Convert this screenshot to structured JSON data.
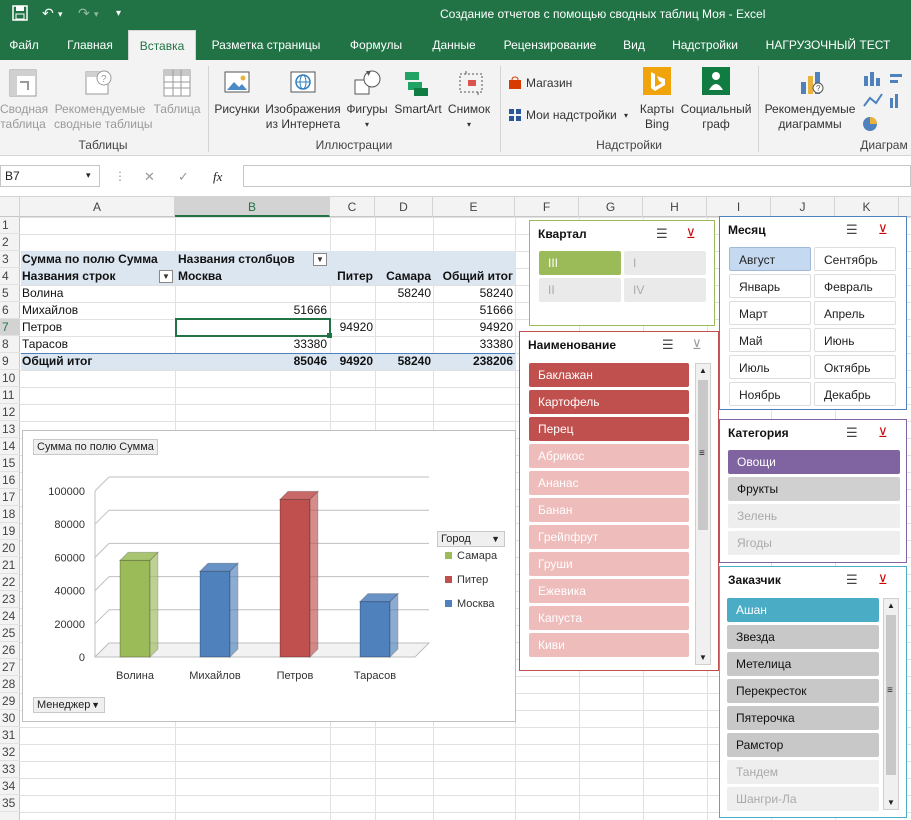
{
  "window": {
    "title": "Создание отчетов с помощью сводных таблиц Моя - Excel"
  },
  "tabs": [
    "Файл",
    "Главная",
    "Вставка",
    "Разметка страницы",
    "Формулы",
    "Данные",
    "Рецензирование",
    "Вид",
    "Надстройки",
    "НАГРУЗОЧНЫЙ ТЕСТ"
  ],
  "ribbon": {
    "pivot_1": "Сводная",
    "pivot_2": "таблица",
    "recpivot_1": "Рекомендуемые",
    "recpivot_2": "сводные таблицы",
    "table": "Таблица",
    "pictures": "Рисунки",
    "online_1": "Изображения",
    "online_2": "из Интернета",
    "shapes": "Фигуры",
    "smartart": "SmartArt",
    "screenshot": "Снимок",
    "store": "Магазин",
    "myaddins": "Мои надстройки",
    "bing_1": "Карты",
    "bing_2": "Bing",
    "social_1": "Социальный",
    "social_2": "граф",
    "recchart_1": "Рекомендуемые",
    "recchart_2": "диаграммы",
    "groups": {
      "tables": "Таблицы",
      "illustrations": "Иллюстрации",
      "addins": "Надстройки",
      "charts": "Диаграм"
    }
  },
  "formula_bar": {
    "name_box": "B7",
    "fx": "fx",
    "cancel": "✕",
    "enter": "✓",
    "value": ""
  },
  "columns": [
    "A",
    "B",
    "C",
    "D",
    "E",
    "F",
    "G",
    "H",
    "I",
    "J",
    "K"
  ],
  "rows": [
    "1",
    "2",
    "3",
    "4",
    "5",
    "6",
    "7",
    "8",
    "9",
    "10",
    "11",
    "12",
    "13",
    "14",
    "15",
    "16",
    "17",
    "18",
    "19",
    "20",
    "21",
    "22",
    "23",
    "24",
    "25",
    "26",
    "27",
    "28",
    "29",
    "30",
    "31",
    "32",
    "33",
    "34",
    "35"
  ],
  "pivot": {
    "values_label": "Сумма по полю Сумма",
    "col_labels": "Названия столбцов",
    "row_labels": "Названия строк",
    "headers": [
      "Москва",
      "Питер",
      "Самара",
      "Общий итог"
    ],
    "rows": [
      {
        "name": "Волина",
        "moscow": "",
        "piter": "",
        "samara": "58240",
        "total": "58240"
      },
      {
        "name": "Михайлов",
        "moscow": "51666",
        "piter": "",
        "samara": "",
        "total": "51666"
      },
      {
        "name": "Петров",
        "moscow": "",
        "piter": "94920",
        "samara": "",
        "total": "94920"
      },
      {
        "name": "Тарасов",
        "moscow": "33380",
        "piter": "",
        "samara": "",
        "total": "33380"
      }
    ],
    "grand": {
      "name": "Общий итог",
      "moscow": "85046",
      "piter": "94920",
      "samara": "58240",
      "total": "238206"
    }
  },
  "chart": {
    "title_button": "Сумма по полю Сумма",
    "legend_button": "Город",
    "axis_button": "Менеджер",
    "colors": {
      "Самара": "#9bbb59",
      "Питер": "#c0504d",
      "Москва": "#4f81bd"
    }
  },
  "chart_data": {
    "type": "bar",
    "categories": [
      "Волина",
      "Михайлов",
      "Петров",
      "Тарасов"
    ],
    "series": [
      {
        "name": "Самара",
        "values": [
          58240,
          null,
          null,
          null
        ]
      },
      {
        "name": "Питер",
        "values": [
          null,
          null,
          94920,
          null
        ]
      },
      {
        "name": "Москва",
        "values": [
          null,
          51666,
          null,
          33380
        ]
      }
    ],
    "yticks": [
      "0",
      "20000",
      "40000",
      "60000",
      "80000",
      "100000"
    ],
    "ylim": [
      0,
      100000
    ],
    "legend_position": "right",
    "grid": true
  },
  "slicers": {
    "quarter": {
      "title": "Квартал",
      "items": [
        "III",
        "I",
        "II",
        "IV"
      ]
    },
    "month": {
      "title": "Месяц",
      "items": [
        "Август",
        "Сентябрь",
        "Январь",
        "Февраль",
        "Март",
        "Апрель",
        "Май",
        "Июнь",
        "Июль",
        "Октябрь",
        "Ноябрь",
        "Декабрь"
      ]
    },
    "name": {
      "title": "Наименование",
      "items": [
        "Баклажан",
        "Картофель",
        "Перец",
        "Абрикос",
        "Ананас",
        "Банан",
        "Грейпфрут",
        "Груши",
        "Ежевика",
        "Капуста",
        "Киви"
      ]
    },
    "category": {
      "title": "Категория",
      "items": [
        "Овощи",
        "Фрукты",
        "Зелень",
        "Ягоды"
      ]
    },
    "customer": {
      "title": "Заказчик",
      "items": [
        "Ашан",
        "Звезда",
        "Метелица",
        "Перекресток",
        "Пятерочка",
        "Рамстор",
        "Тандем",
        "Шангри-Ла"
      ]
    }
  }
}
